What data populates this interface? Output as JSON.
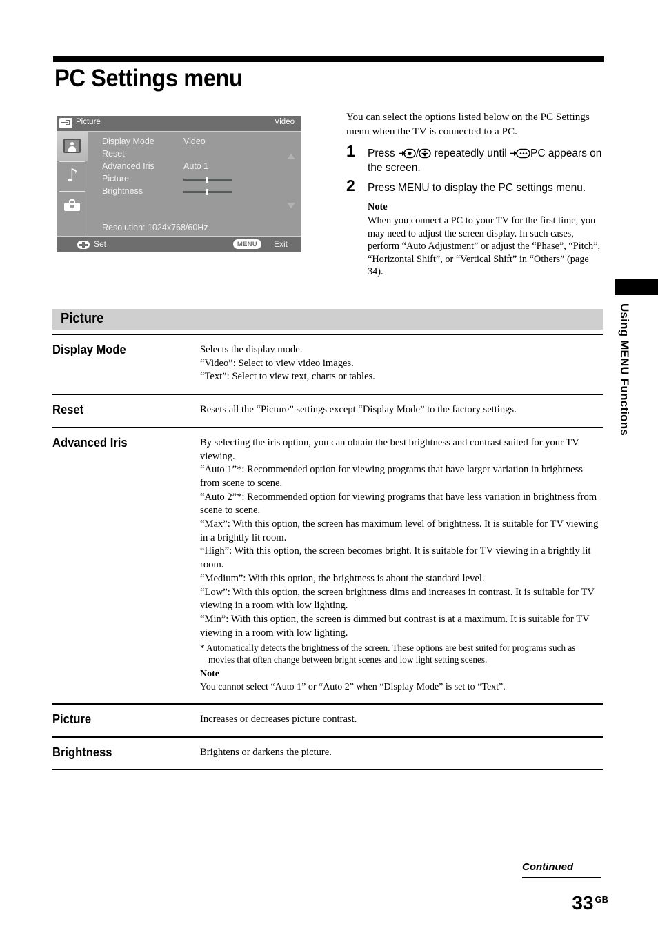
{
  "page_title": "PC Settings menu",
  "osd": {
    "title": "Picture",
    "title_right": "Video",
    "input_icon": "input-source-icon",
    "sidebar_icons": [
      "picture-icon",
      "sound-note-icon",
      "toolbox-icon"
    ],
    "rows": [
      {
        "label": "Display Mode",
        "value": "Video",
        "type": "value"
      },
      {
        "label": "Reset",
        "value": "",
        "type": "value"
      },
      {
        "label": "Advanced Iris",
        "value": "Auto 1",
        "type": "value"
      },
      {
        "label": "Picture",
        "value": "",
        "type": "slider",
        "position": 47
      },
      {
        "label": "Brightness",
        "value": "",
        "type": "slider",
        "position": 47
      }
    ],
    "resolution": "Resolution: 1024x768/60Hz",
    "footer": {
      "set_label": "Set",
      "menu_pill": "MENU",
      "exit_label": "Exit"
    }
  },
  "intro": {
    "paragraph": "You can select the options listed below on the PC Settings menu when the TV is connected to a PC.",
    "steps": [
      {
        "number": "1",
        "text_before": "Press ",
        "text_middle": "/",
        "text_after": " repeatedly until ",
        "text_end": "PC appears on the screen."
      },
      {
        "number": "2",
        "text": "Press MENU to display the PC settings menu."
      }
    ],
    "note_heading": "Note",
    "note_text": "When you connect a PC to your TV for the first time, you may need to adjust the screen display. In such cases, perform “Auto Adjustment” or adjust the “Phase”, “Pitch”, “Horizontal Shift”, or “Vertical Shift” in “Others” (page 34)."
  },
  "section": {
    "banner": "Picture"
  },
  "table": {
    "rows": [
      {
        "label": "Display Mode",
        "lines": [
          "Selects the display mode.",
          "“Video”: Select to view video images.",
          "“Text”: Select to view text, charts or tables."
        ]
      },
      {
        "label": "Reset",
        "lines": [
          "Resets all the “Picture” settings except “Display Mode” to the factory settings."
        ]
      },
      {
        "label": "Advanced Iris",
        "lines": [
          "By selecting the iris option, you can obtain the best brightness and contrast suited for your TV viewing.",
          "“Auto 1”*: Recommended option for viewing programs that have larger variation in brightness from scene to scene.",
          "“Auto 2”*: Recommended option for viewing programs that have less variation in brightness from scene to scene.",
          "“Max”: With this option, the screen has maximum level of brightness. It is suitable for TV viewing in a brightly lit room.",
          "“High”: With this option, the screen becomes bright. It is suitable for TV viewing in a brightly lit room.",
          "“Medium”: With this option, the brightness is about the standard level.",
          "“Low”: With this option, the screen brightness dims and increases in contrast. It is suitable for TV viewing in a room with low lighting.",
          "“Min”: With this option, the screen is dimmed but contrast is at a maximum. It is suitable for TV viewing in a room with low lighting."
        ],
        "footnote": "* Automatically detects the brightness of the screen. These options are best suited for programs such as movies that often change between bright scenes and low light setting scenes.",
        "note_heading": "Note",
        "note_text": "You cannot select “Auto 1” or “Auto 2” when “Display Mode” is set to “Text”."
      },
      {
        "label": "Picture",
        "lines": [
          "Increases or decreases picture contrast."
        ]
      },
      {
        "label": "Brightness",
        "lines": [
          "Brightens or darkens the picture."
        ]
      }
    ]
  },
  "edge": {
    "text": "Using MENU Functions"
  },
  "footer": {
    "continued": "Continued",
    "page_number": "33",
    "page_suffix": "GB"
  },
  "colors": {
    "banner_gray": "#cfcfcf",
    "osd_bg": "#9a9a9a",
    "osd_bar": "#6e6e6e",
    "rule_black": "#000000"
  }
}
